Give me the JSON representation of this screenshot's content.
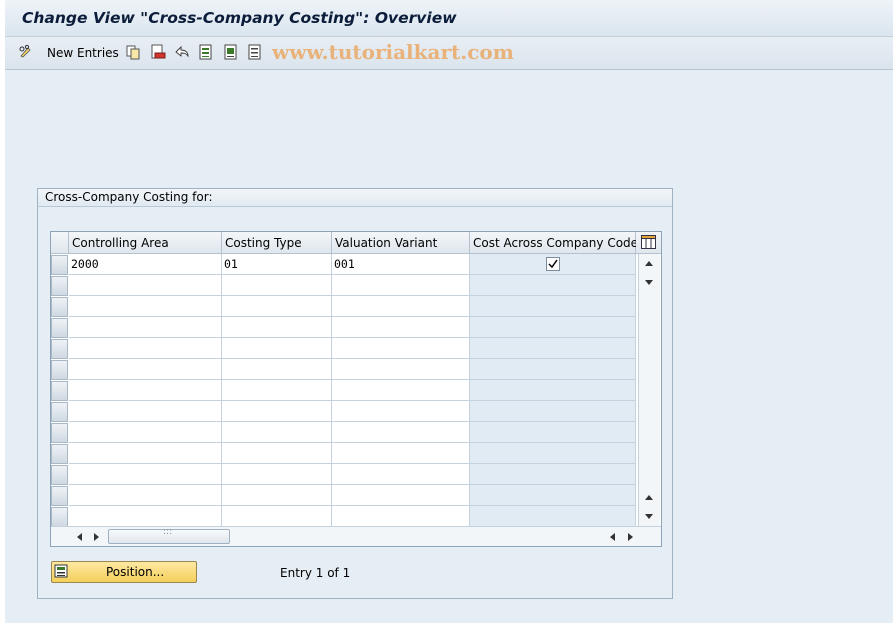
{
  "window": {
    "title": "Change View \"Cross-Company Costing\": Overview"
  },
  "toolbar": {
    "new_entries_label": "New Entries",
    "watermark": "www.tutorialkart.com",
    "icons": [
      "pencil-glasses-icon",
      "copy-icon",
      "delete-icon",
      "undo-icon",
      "select-all-icon",
      "select-block-icon",
      "deselect-all-icon"
    ]
  },
  "group": {
    "title": "Cross-Company Costing for:",
    "columns": [
      "Controlling Area",
      "Costing Type",
      "Valuation Variant",
      "Cost Across Company Codes"
    ],
    "rows": [
      {
        "controlling_area": "2000",
        "costing_type": "01",
        "valuation_variant": "001",
        "cost_across_company_codes": true
      }
    ],
    "empty_rows": 12,
    "position_button_label": "Position...",
    "entry_info": "Entry 1 of 1"
  },
  "colors": {
    "background": "#e6eef5",
    "readonly_cell": "#e1ebf4",
    "button": "#f4cf5b"
  }
}
